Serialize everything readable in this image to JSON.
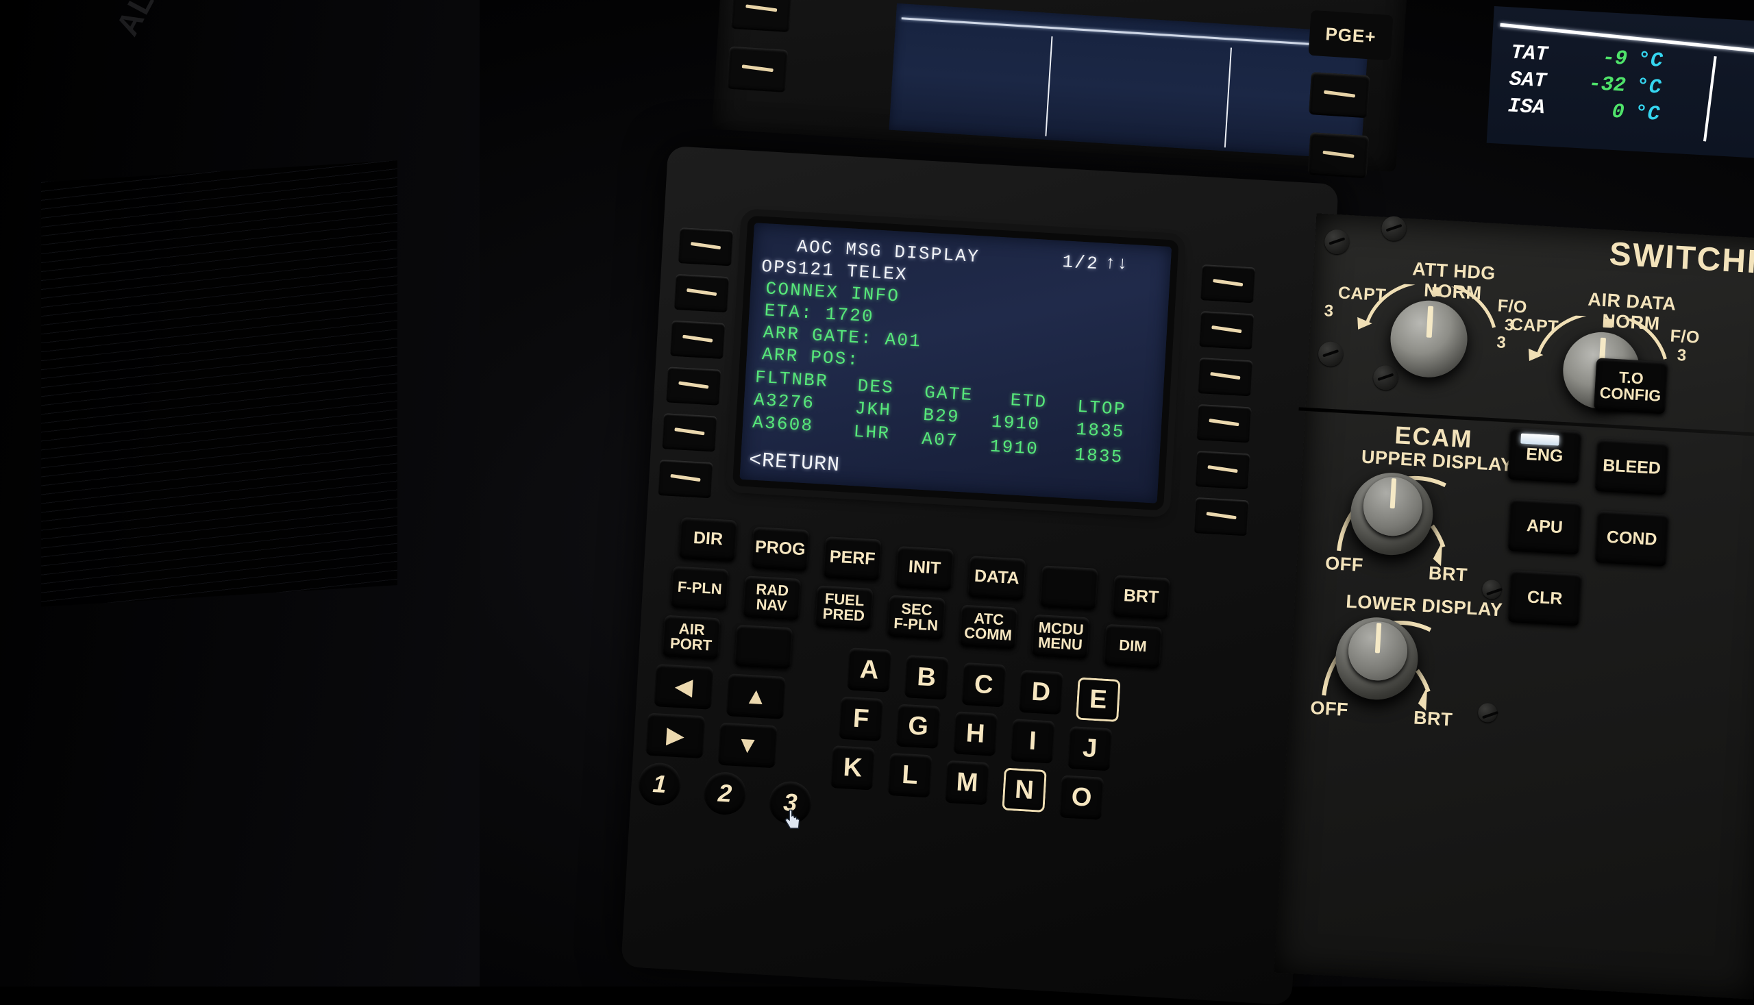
{
  "scene": {
    "title": "Airbus A320 MCDU AOC MSG DISPLAY",
    "pedal_text": "ALS"
  },
  "colors": {
    "screen_bg": "#1e2844",
    "text_green": "#56e87a",
    "text_white": "#f2f4f8",
    "text_cyan": "#35d6f0",
    "key_label": "#f6e6c0"
  },
  "ecam_strip": {
    "rows": [
      {
        "label": "TAT",
        "value": "-9",
        "unit": "°C"
      },
      {
        "label": "SAT",
        "value": "-32",
        "unit": "°C"
      },
      {
        "label": "ISA",
        "value": "0",
        "unit": "°C"
      }
    ]
  },
  "upper_unit": {
    "page_plus_label": "PGE+"
  },
  "mcdu_screen": {
    "title": "AOC MSG DISPLAY",
    "page_indicator": "1/2",
    "page_arrows": "↑↓",
    "subtitle": "OPS121 TELEX",
    "lines": [
      "CONNEX INFO",
      "ETA: 1720",
      "ARR GATE: A01",
      "ARR POS:"
    ],
    "table": {
      "headers": [
        "FLTNBR",
        "DES",
        "GATE",
        "ETD",
        "LTOP"
      ],
      "rows": [
        [
          "A3276",
          "JKH",
          "B29",
          "1910",
          "1835"
        ],
        [
          "A3608",
          "LHR",
          "A07",
          "1910",
          "1835"
        ]
      ]
    },
    "return_label": "<RETURN"
  },
  "mcdu_keys": {
    "function_rows": [
      [
        "DIR",
        "PROG",
        "PERF",
        "INIT",
        "DATA",
        "",
        "BRT"
      ],
      [
        "F-PLN",
        "RAD\nNAV",
        "FUEL\nPRED",
        "SEC\nF-PLN",
        "ATC\nCOMM",
        "MCDU\nMENU",
        "DIM"
      ],
      [
        "AIR\nPORT",
        ""
      ]
    ],
    "arrows": [
      "◀",
      "▲",
      "▶",
      "▼"
    ],
    "letters_row1": [
      "A",
      "B",
      "C",
      "D",
      "E"
    ],
    "letters_row2": [
      "F",
      "G",
      "H",
      "I",
      "J"
    ],
    "letters_row3": [
      "K",
      "L",
      "M",
      "N",
      "O"
    ],
    "boxed_letters": [
      "E",
      "N"
    ],
    "numbers_row": [
      "1",
      "2",
      "3"
    ]
  },
  "right_panel": {
    "heading": "SWITCHING",
    "selectors": [
      {
        "title": "ATT HDG",
        "norm": "NORM",
        "left": "CAPT",
        "left_sub": "3",
        "right": "F/O",
        "right_sub": "3"
      },
      {
        "title": "AIR DATA",
        "norm": "NORM",
        "left": "CAPT",
        "left_sub": "3",
        "right": "F/O",
        "right_sub": "3"
      }
    ],
    "ecam": {
      "title": "ECAM",
      "upper_label": "UPPER DISPLAY",
      "lower_label": "LOWER DISPLAY",
      "off": "OFF",
      "brt": "BRT"
    },
    "system_buttons": [
      {
        "label": "T.O\nCONFIG",
        "lit": false
      },
      {
        "label": "ENG",
        "lit": true
      },
      {
        "label": "BLEED",
        "lit": false
      },
      {
        "label": "APU",
        "lit": false
      },
      {
        "label": "COND",
        "lit": false
      },
      {
        "label": "CLR",
        "lit": false
      }
    ]
  }
}
